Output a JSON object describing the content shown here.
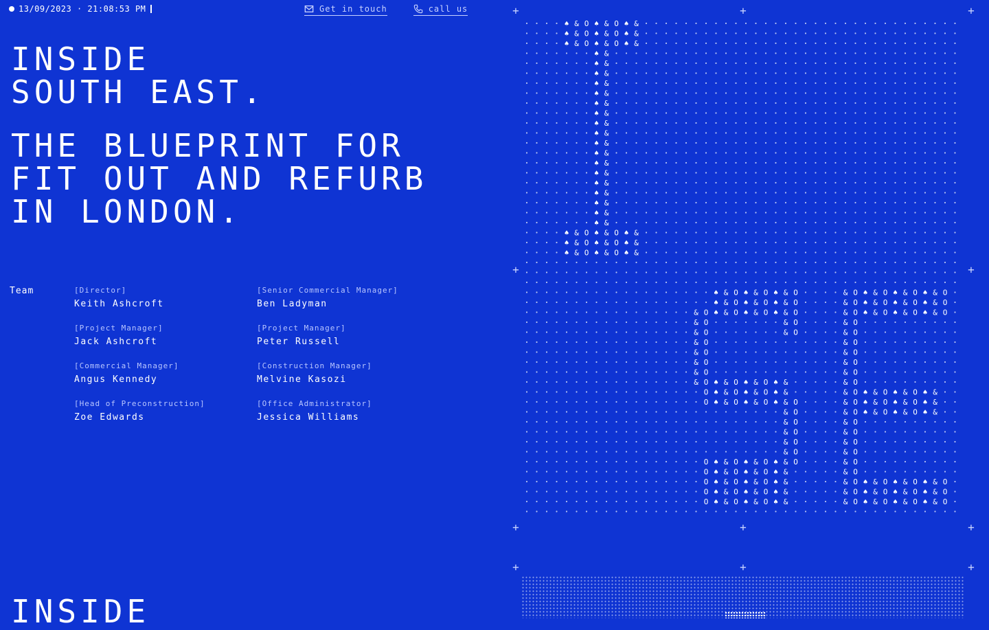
{
  "status": {
    "datetime": "13/09/2023 · 21:08:53 PM"
  },
  "nav": {
    "get_in_touch": "Get in touch",
    "call_us": "call us"
  },
  "hero": {
    "title": "INSIDE\nSOUTH EAST.",
    "tagline": "THE BLUEPRINT FOR\nFIT OUT AND REFURB\nIN LONDON.",
    "next_title": "INSIDE"
  },
  "team": {
    "label": "Team",
    "left": [
      {
        "role": "[Director]",
        "name": "Keith Ashcroft"
      },
      {
        "role": "[Project Manager]",
        "name": "Jack Ashcroft"
      },
      {
        "role": "[Commercial Manager]",
        "name": "Angus Kennedy"
      },
      {
        "role": "[Head of Preconstruction]",
        "name": "Zoe Edwards"
      }
    ],
    "right": [
      {
        "role": "[Senior Commercial Manager]",
        "name": "Ben Ladyman"
      },
      {
        "role": "[Project Manager]",
        "name": "Peter Russell"
      },
      {
        "role": "[Construction Manager]",
        "name": "Melvine Kasozi"
      },
      {
        "role": "[Office Administrator]",
        "name": "Jessica Williams"
      }
    ]
  },
  "art": {
    "logo_letters": [
      "I",
      "S",
      "E"
    ],
    "glyphs": [
      "O",
      "♠",
      "&"
    ]
  },
  "colors": {
    "background": "#0f34d3",
    "foreground": "#ffffff",
    "muted": "#b9c6ff"
  }
}
